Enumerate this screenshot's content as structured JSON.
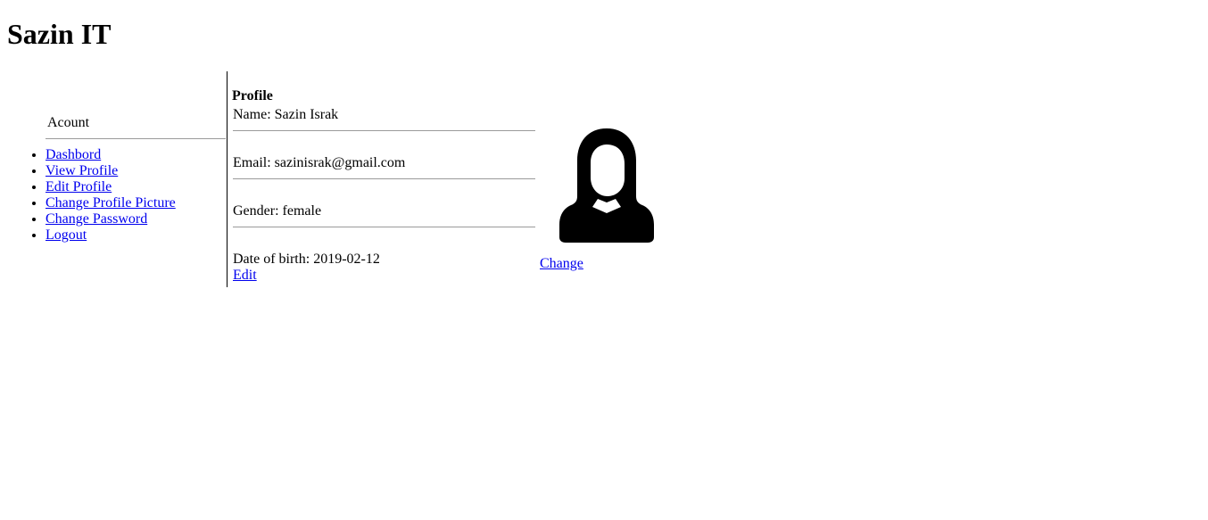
{
  "header": {
    "site_title": "Sazin IT"
  },
  "sidebar": {
    "heading": "Acount",
    "items": [
      {
        "label": "Dashbord"
      },
      {
        "label": "View Profile"
      },
      {
        "label": "Edit Profile"
      },
      {
        "label": "Change Profile Picture"
      },
      {
        "label": "Change Password"
      },
      {
        "label": "Logout"
      }
    ]
  },
  "profile": {
    "title": "Profile",
    "name": "Name: Sazin Israk",
    "email": "Email: sazinisrak@gmail.com",
    "gender": "Gender: female",
    "dob": "Date of birth: 2019-02-12",
    "edit_label": "Edit"
  },
  "avatar": {
    "icon": "female-user-icon",
    "change_label": "Change"
  }
}
